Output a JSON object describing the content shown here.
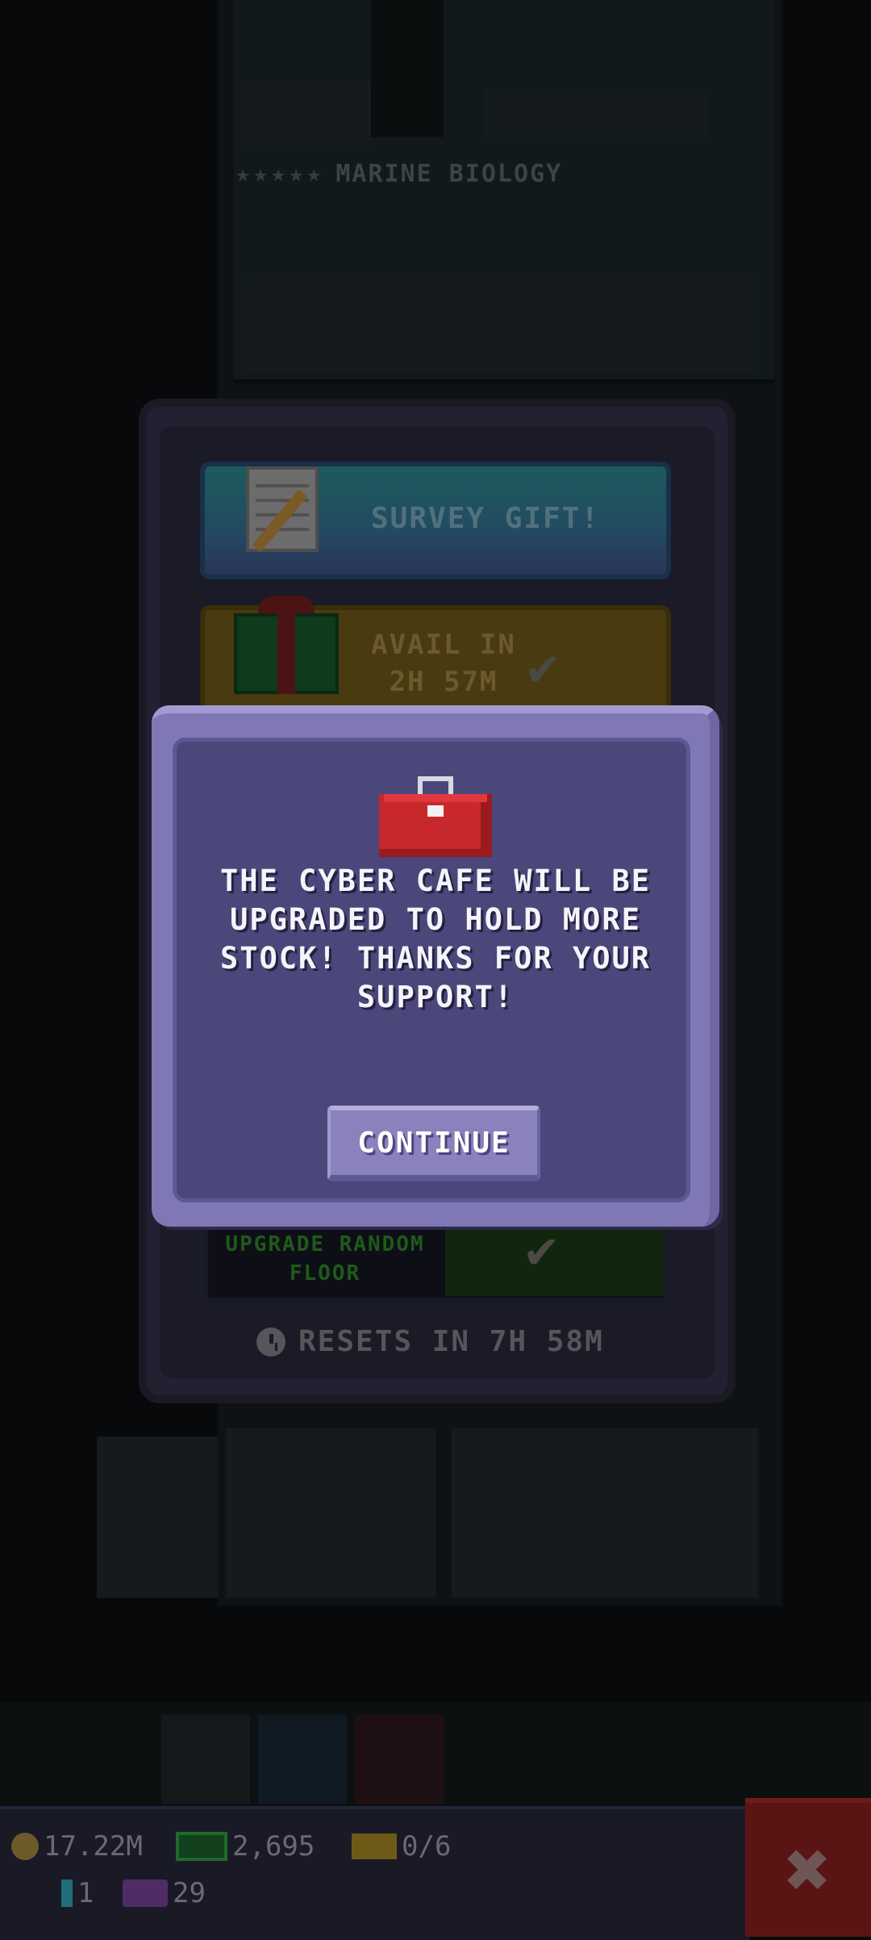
{
  "background": {
    "floor_title": "MARINE BIOLOGY",
    "floor_stars": "★★★★★"
  },
  "daily_panel": {
    "survey_label": "SURVEY GIFT!",
    "gift_label_line1": "AVAIL IN",
    "gift_label_line2": "2H 57M",
    "upgrade_label_line1": "UPGRADE RANDOM",
    "upgrade_label_line2": "FLOOR",
    "resets_label": "RESETS IN 7H 58M"
  },
  "dialog": {
    "message": "THE CYBER CAFE WILL BE UPGRADED TO HOLD MORE STOCK! THANKS FOR YOUR SUPPORT!",
    "continue_label": "CONTINUE",
    "icon": "toolbox-icon"
  },
  "status_bar": {
    "coins": "17.22M",
    "bux": "2,695",
    "tickets": "0/6",
    "gems": "1",
    "tv_count": "29"
  },
  "icons": {
    "close": "✖",
    "check": "✔"
  },
  "colors": {
    "dialog_border": "#8078b4",
    "dialog_fill": "#4b477a",
    "toolbox_red": "#c7282c",
    "close_button": "#5a1414"
  }
}
